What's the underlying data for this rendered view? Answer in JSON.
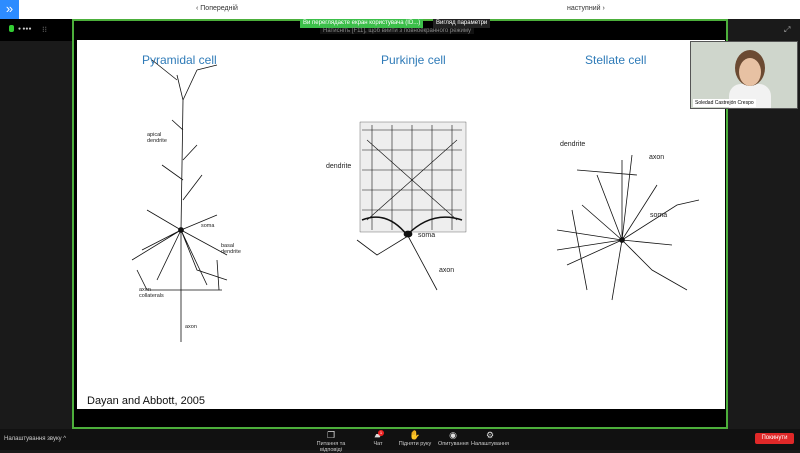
{
  "topbar": {
    "prev": "‹ Попередній",
    "next": "наступний ›",
    "collapse_icon": "double-chevron-right-icon"
  },
  "status": {
    "rec": "● ●●●"
  },
  "notice": {
    "banner": "Ви переглядаєте екран користувача (ID...)",
    "banner2": "Вигляд параметри",
    "sub": "Натисніть [F11], щоб вийти з повноекранного режиму"
  },
  "slide": {
    "titles": [
      "Pyramidal cell",
      "Purkinje cell",
      "Stellate cell"
    ],
    "pyramidal_labels": {
      "apical": "apical dendrite",
      "soma": "soma",
      "basal": "basal dendrite",
      "collaterals": "axon collaterals",
      "axon": "axon"
    },
    "purkinje_labels": {
      "dendrite": "dendrite",
      "soma": "soma",
      "axon": "axon"
    },
    "stellate_labels": {
      "dendrite": "dendrite",
      "axon": "axon",
      "soma": "soma"
    },
    "citation": "Dayan and Abbott, 2005"
  },
  "video": {
    "name": "Soledad Castrejón Crespo"
  },
  "bottom": {
    "audio": "Налаштування звуку ^",
    "tools": [
      {
        "label": "Питання та відповіді",
        "icon": "qa-icon"
      },
      {
        "label": "Чат",
        "icon": "chat-icon",
        "badge": "1"
      },
      {
        "label": "Підняти руку",
        "icon": "raise-hand-icon"
      },
      {
        "label": "Опитування",
        "icon": "poll-icon"
      },
      {
        "label": "Налаштування",
        "icon": "gear-icon"
      }
    ],
    "leave": "Покинути"
  }
}
